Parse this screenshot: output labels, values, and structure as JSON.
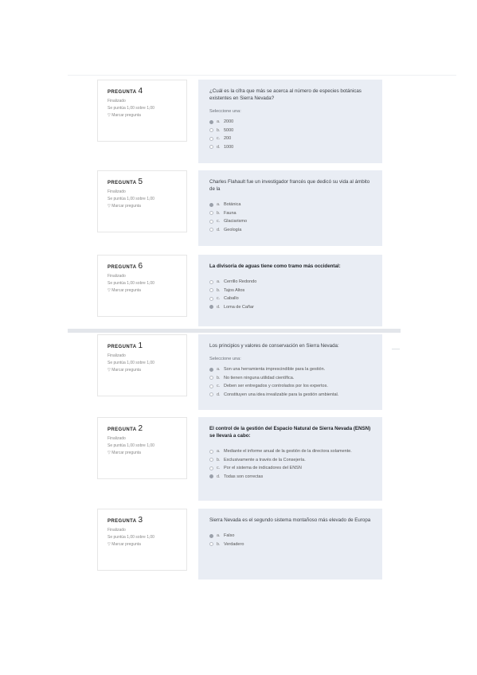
{
  "questions": [
    {
      "label": "PREGUNTA",
      "number": "4",
      "status": "Finalizado",
      "score": "Se puntúa 1,00 sobre 1,00",
      "flag": "Marcar pregunta",
      "text": "¿Cuál es la cifra que más se acerca al número de especies botánicas existentes en Sierra Nevada?",
      "bold": false,
      "prompt": "Seleccione una:",
      "options": [
        {
          "letter": "a.",
          "text": "2000",
          "checked": true
        },
        {
          "letter": "b.",
          "text": "5000",
          "checked": false
        },
        {
          "letter": "c.",
          "text": "200",
          "checked": false
        },
        {
          "letter": "d.",
          "text": "1000",
          "checked": false
        }
      ]
    },
    {
      "label": "PREGUNTA",
      "number": "5",
      "status": "Finalizado",
      "score": "Se puntúa 1,00 sobre 1,00",
      "flag": "Marcar pregunta",
      "text": "Charles Flahault fue un investigador francés que dedicó su vida al ámbito de la",
      "bold": false,
      "prompt": "",
      "options": [
        {
          "letter": "a.",
          "text": "Botánica",
          "checked": true
        },
        {
          "letter": "b.",
          "text": "Fauna",
          "checked": false
        },
        {
          "letter": "c.",
          "text": "Glaciarismo",
          "checked": false
        },
        {
          "letter": "d.",
          "text": "Geología",
          "checked": false
        }
      ]
    },
    {
      "label": "PREGUNTA",
      "number": "6",
      "status": "Finalizado",
      "score": "Se puntúa 1,00 sobre 1,00",
      "flag": "Marcar pregunta",
      "text": "La divisoria de aguas tiene como tramo más occidental:",
      "bold": true,
      "prompt": "",
      "options": [
        {
          "letter": "a.",
          "text": "Cerrillo Redondo",
          "checked": false
        },
        {
          "letter": "b.",
          "text": "Tajos Altos",
          "checked": false
        },
        {
          "letter": "c.",
          "text": "Caballo",
          "checked": false
        },
        {
          "letter": "d.",
          "text": "Loma de Cañar",
          "checked": true
        }
      ]
    },
    {
      "label": "PREGUNTA",
      "number": "1",
      "status": "Finalizado",
      "score": "Se puntúa 1,00 sobre 1,00",
      "flag": "Marcar pregunta",
      "text": "Los principios y valores de conservación en Sierra Nevada:",
      "bold": false,
      "prompt": "Seleccione una:",
      "options": [
        {
          "letter": "a.",
          "text": "Son una herramienta imprescindible para la gestión.",
          "checked": true
        },
        {
          "letter": "b.",
          "text": "No tienen ninguna utilidad científica.",
          "checked": false
        },
        {
          "letter": "c.",
          "text": "Deben ser entregados y controlados por los expertos.",
          "checked": false
        },
        {
          "letter": "d.",
          "text": "Constituyen una idea irrealizable para la gestión ambiental.",
          "checked": false
        }
      ]
    },
    {
      "label": "PREGUNTA",
      "number": "2",
      "status": "Finalizado",
      "score": "Se puntúa 1,00 sobre 1,00",
      "flag": "Marcar pregunta",
      "text": "El control de la gestión del Espacio Natural de Sierra Nevada (ENSN) se llevará a cabo:",
      "bold": true,
      "prompt": "",
      "options": [
        {
          "letter": "a.",
          "text": "Mediante el informe anual de la gestión de la directora solamente.",
          "checked": false
        },
        {
          "letter": "b.",
          "text": "Exclusivamente a través de la Consejería.",
          "checked": false
        },
        {
          "letter": "c.",
          "text": "Por el sistema de indicadores del ENSN",
          "checked": false
        },
        {
          "letter": "d.",
          "text": "Todas son correctas",
          "checked": true
        }
      ]
    },
    {
      "label": "PREGUNTA",
      "number": "3",
      "status": "Finalizado",
      "score": "Se puntúa 1,00 sobre 1,00",
      "flag": "Marcar pregunta",
      "text": "Sierra Nevada es el segundo sistema montañoso más elevado de Europa",
      "bold": false,
      "prompt": "",
      "options": [
        {
          "letter": "a.",
          "text": "Falso",
          "checked": true
        },
        {
          "letter": "b.",
          "text": "Verdadero",
          "checked": false
        }
      ]
    }
  ]
}
